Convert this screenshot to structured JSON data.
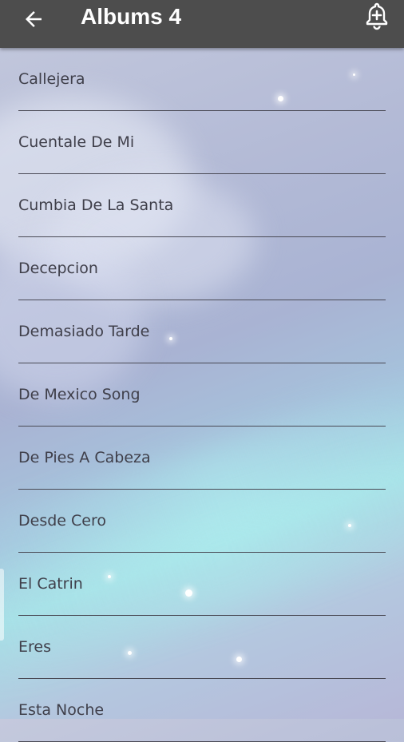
{
  "app_bar": {
    "title": "Albums 4",
    "back_icon": "arrow-left-icon",
    "action_icon": "bell-plus-icon"
  },
  "songs": [
    "Callejera",
    "Cuentale De Mi",
    "Cumbia De La Santa",
    "Decepcion",
    "Demasiado Tarde",
    "De Mexico Song",
    "De Pies A Cabeza",
    "Desde Cero",
    "El Catrin",
    "Eres",
    "Esta Noche"
  ],
  "colors": {
    "app_bar": "#4d4d4d",
    "title": "#ffffff",
    "row_text": "#3f3f4a",
    "divider": "#4a4a55"
  }
}
